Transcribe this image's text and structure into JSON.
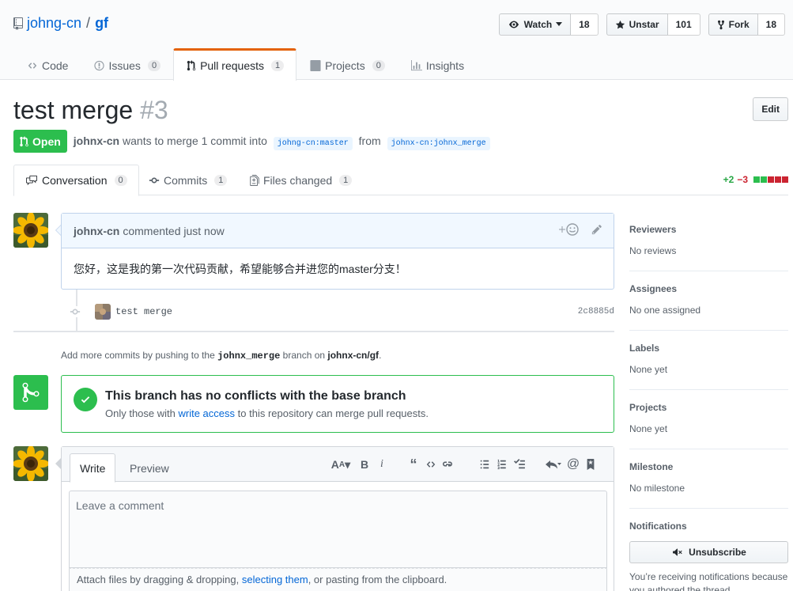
{
  "repo": {
    "owner": "johng-cn",
    "separator": "/",
    "name": "gf"
  },
  "actions": {
    "watch_label": "Watch",
    "watch_count": "18",
    "star_label": "Unstar",
    "star_count": "101",
    "fork_label": "Fork",
    "fork_count": "18"
  },
  "reponav": {
    "code": "Code",
    "issues": "Issues",
    "issues_count": "0",
    "pulls": "Pull requests",
    "pulls_count": "1",
    "projects": "Projects",
    "projects_count": "0",
    "insights": "Insights"
  },
  "pr": {
    "title": "test merge",
    "number": "#3",
    "edit_label": "Edit",
    "state": "Open",
    "author": "johnx-cn",
    "meta_text": "wants to merge 1 commit into",
    "base_ref": "johng-cn:master",
    "from_text": "from",
    "head_ref": "johnx-cn:johnx_merge"
  },
  "tabs": {
    "conversation": "Conversation",
    "conversation_count": "0",
    "commits": "Commits",
    "commits_count": "1",
    "files": "Files changed",
    "files_count": "1",
    "additions": "+2",
    "deletions": "−3"
  },
  "comment": {
    "author": "johnx-cn",
    "time_text": "commented just now",
    "body": "您好，这是我的第一次代码贡献，希望能够合并进您的master分支！"
  },
  "commit": {
    "message": "test merge",
    "sha": "2c8885d"
  },
  "push_hint": {
    "prefix": "Add more commits by pushing to the",
    "branch": "johnx_merge",
    "middle": "branch on",
    "repo": "johnx-cn/gf",
    "suffix": "."
  },
  "merge": {
    "title": "This branch has no conflicts with the base branch",
    "sub_prefix": "Only those with",
    "sub_link": "write access",
    "sub_suffix": "to this repository can merge pull requests."
  },
  "new_comment": {
    "write_tab": "Write",
    "preview_tab": "Preview",
    "placeholder": "Leave a comment",
    "attach_prefix": "Attach files by dragging & dropping,",
    "attach_link": "selecting them",
    "attach_suffix": ", or pasting from the clipboard."
  },
  "sidebar": {
    "reviewers_heading": "Reviewers",
    "reviewers_value": "No reviews",
    "assignees_heading": "Assignees",
    "assignees_value": "No one assigned",
    "labels_heading": "Labels",
    "labels_value": "None yet",
    "projects_heading": "Projects",
    "projects_value": "None yet",
    "milestone_heading": "Milestone",
    "milestone_value": "No milestone",
    "notifications_heading": "Notifications",
    "unsubscribe_label": "Unsubscribe",
    "notif_text": "You’re receiving notifications because you authored the thread."
  },
  "colors": {
    "green": "#2cbe4e",
    "link": "#0366d6",
    "orange_tab": "#e36209",
    "red": "#cb2431"
  }
}
